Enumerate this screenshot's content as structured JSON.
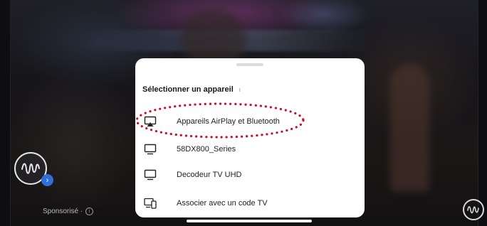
{
  "sheet": {
    "title": "Sélectionner un appareil",
    "title_mark": "ι",
    "devices": [
      {
        "label": "Appareils AirPlay et Bluetooth",
        "icon": "airplay-icon"
      },
      {
        "label": "58DX800_Series",
        "icon": "tv-icon"
      },
      {
        "label": "Decodeur TV UHD",
        "icon": "tv-icon"
      },
      {
        "label": "Associer avec un code TV",
        "icon": "link-tv-code-icon"
      }
    ]
  },
  "ad": {
    "sponsored_label": "Sponsorisé ·",
    "info_icon": "info-icon",
    "badge_icon": "chevron-right-icon",
    "logo_icon": "waveform-logo-icon"
  },
  "colors": {
    "annotation": "#c8102e",
    "badge": "#2f6fd6",
    "sheet_bg": "#ffffff"
  }
}
